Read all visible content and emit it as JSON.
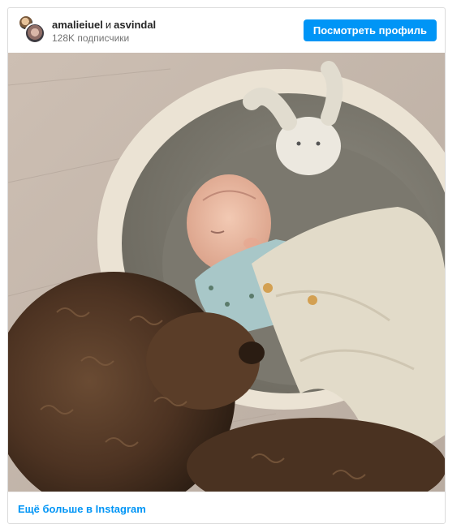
{
  "post": {
    "account_primary": "amalieiuel",
    "connector": "и",
    "account_secondary": "asvindal",
    "followers": "128K подписчики",
    "view_profile_label": "Посмотреть профиль",
    "photo": {
      "description_icon": "photo-newborn-dog"
    },
    "more_link": "Ещё больше в Instagram"
  },
  "colors": {
    "accent": "#0095f6",
    "text": "#262626",
    "secondary_text": "#737373",
    "border": "#dbdbdb"
  }
}
